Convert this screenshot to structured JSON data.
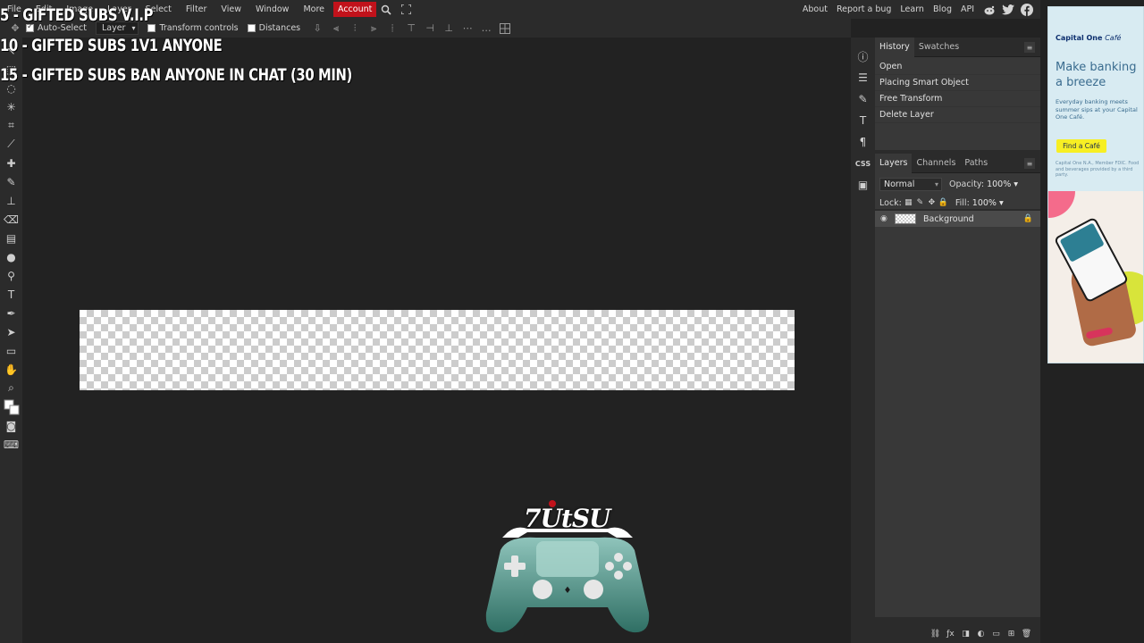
{
  "menubar": {
    "items": [
      "File",
      "Edit",
      "Image",
      "Layer",
      "Select",
      "Filter",
      "View",
      "Window",
      "More"
    ],
    "account": "Account",
    "right_links": [
      "About",
      "Report a bug",
      "Learn",
      "Blog",
      "API"
    ],
    "icons": [
      "search-icon",
      "fullscreen-icon",
      "reddit-icon",
      "twitter-icon",
      "facebook-icon"
    ]
  },
  "options": {
    "auto_select_label": "Auto-Select",
    "auto_select_checked": true,
    "layer_select": "Layer",
    "transform_controls_label": "Transform controls",
    "distances_label": "Distances"
  },
  "overlay_text": {
    "line1": "5 - GIFTED SUBS V.I.P",
    "line2": "10 - GIFTED SUBS 1V1 ANYONE",
    "line3": "15 - GIFTED SUBS BAN ANYONE IN CHAT (30 MIN)"
  },
  "logo": {
    "text": "7UtSU"
  },
  "history": {
    "tabs": [
      "History",
      "Swatches"
    ],
    "rows": [
      "Open",
      "Placing Smart Object",
      "Free Transform",
      "Delete Layer"
    ]
  },
  "layers": {
    "tabs": [
      "Layers",
      "Channels",
      "Paths"
    ],
    "blend_mode": "Normal",
    "opacity_label": "Opacity:",
    "opacity_value": "100%",
    "lock_label": "Lock:",
    "fill_label": "Fill:",
    "fill_value": "100%",
    "items": [
      {
        "name": "Background"
      }
    ]
  },
  "ad": {
    "brand": "Capital One",
    "brand_suffix": "Café",
    "headline": "Make banking a breeze",
    "body": "Everyday banking meets summer sips at your Capital One Café.",
    "cta": "Find a Café",
    "fine": "Capital One N.A., Member FDIC. Food and beverages provided by a third party."
  },
  "colors": {
    "accent": "#c1121b",
    "panel_bg": "#2b2b2b",
    "canvas_bg": "#222222",
    "ad_bg": "#d8ebf2",
    "cta_bg": "#f7ef24"
  }
}
